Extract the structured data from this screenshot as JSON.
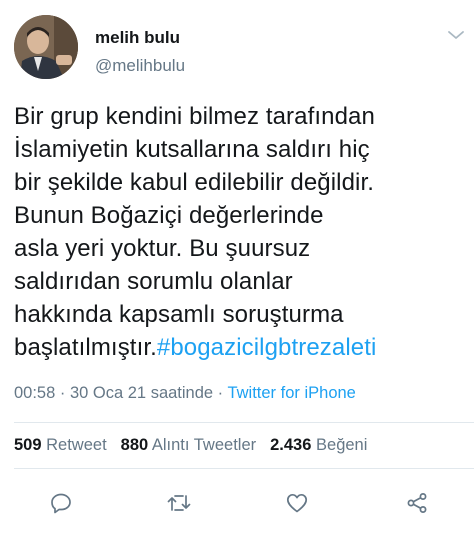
{
  "user": {
    "name": "melih bulu",
    "handle": "@melihbulu"
  },
  "tweet": {
    "lines": [
      "Bir grup kendini bilmez tarafından",
      "İslamiyetin kutsallarına saldırı hiç",
      "bir şekilde kabul edilebilir değildir.",
      "Bunun Boğaziçi değerlerinde",
      "asla yeri yoktur. Bu şuursuz",
      "saldırıdan sorumlu olanlar",
      "hakkında kapsamlı soruşturma"
    ],
    "last_line_prefix": "başlatılmıştır.",
    "hashtag": "#bogazicilgbtrezaleti"
  },
  "meta": {
    "time": "00:58",
    "separator": " · ",
    "date": "30 Oca 21 saatinde",
    "source": "Twitter for iPhone"
  },
  "stats": {
    "retweets_count": "509",
    "retweets_label": "Retweet",
    "quotes_count": "880",
    "quotes_label": "Alıntı Tweetler",
    "likes_count": "2.436",
    "likes_label": "Beğeni"
  },
  "icons": {
    "reply": "reply-icon",
    "retweet": "retweet-icon",
    "like": "heart-icon",
    "share": "share-icon",
    "more": "chevron-down-icon"
  },
  "colors": {
    "link": "#1da1f2",
    "secondary": "#657786",
    "text": "#14171a",
    "icon": "#657786"
  }
}
